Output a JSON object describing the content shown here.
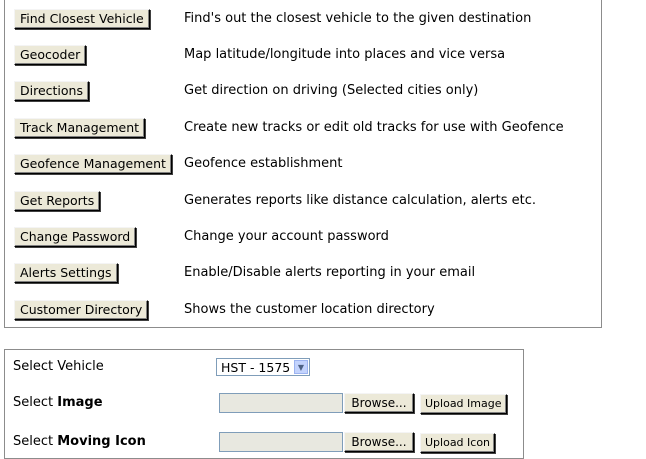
{
  "menu": [
    {
      "button": "Find Closest Vehicle",
      "description": "Find's out the closest vehicle to the given destination"
    },
    {
      "button": "Geocoder",
      "description": "Map latitude/longitude into places and vice versa"
    },
    {
      "button": "Directions",
      "description": "Get direction on driving (Selected cities only)"
    },
    {
      "button": "Track Management",
      "description": "Create new tracks or edit old tracks for use with Geofence"
    },
    {
      "button": "Geofence Management",
      "description": "Geofence establishment"
    },
    {
      "button": "Get Reports",
      "description": "Generates reports like distance calculation, alerts etc."
    },
    {
      "button": "Change Password",
      "description": "Change your account password"
    },
    {
      "button": "Alerts Settings",
      "description": "Enable/Disable alerts reporting in your email"
    },
    {
      "button": "Customer Directory",
      "description": "Shows the customer location directory"
    }
  ],
  "form": {
    "vehicle_label": "Select Vehicle",
    "vehicle_value": "HST - 1575",
    "image_label_prefix": "Select ",
    "image_label_bold": "Image",
    "moving_label_prefix": "Select ",
    "moving_label_bold": "Moving Icon",
    "browse_label": "Browse...",
    "upload_image_label": "Upload Image",
    "upload_icon_label": "Upload Icon"
  }
}
